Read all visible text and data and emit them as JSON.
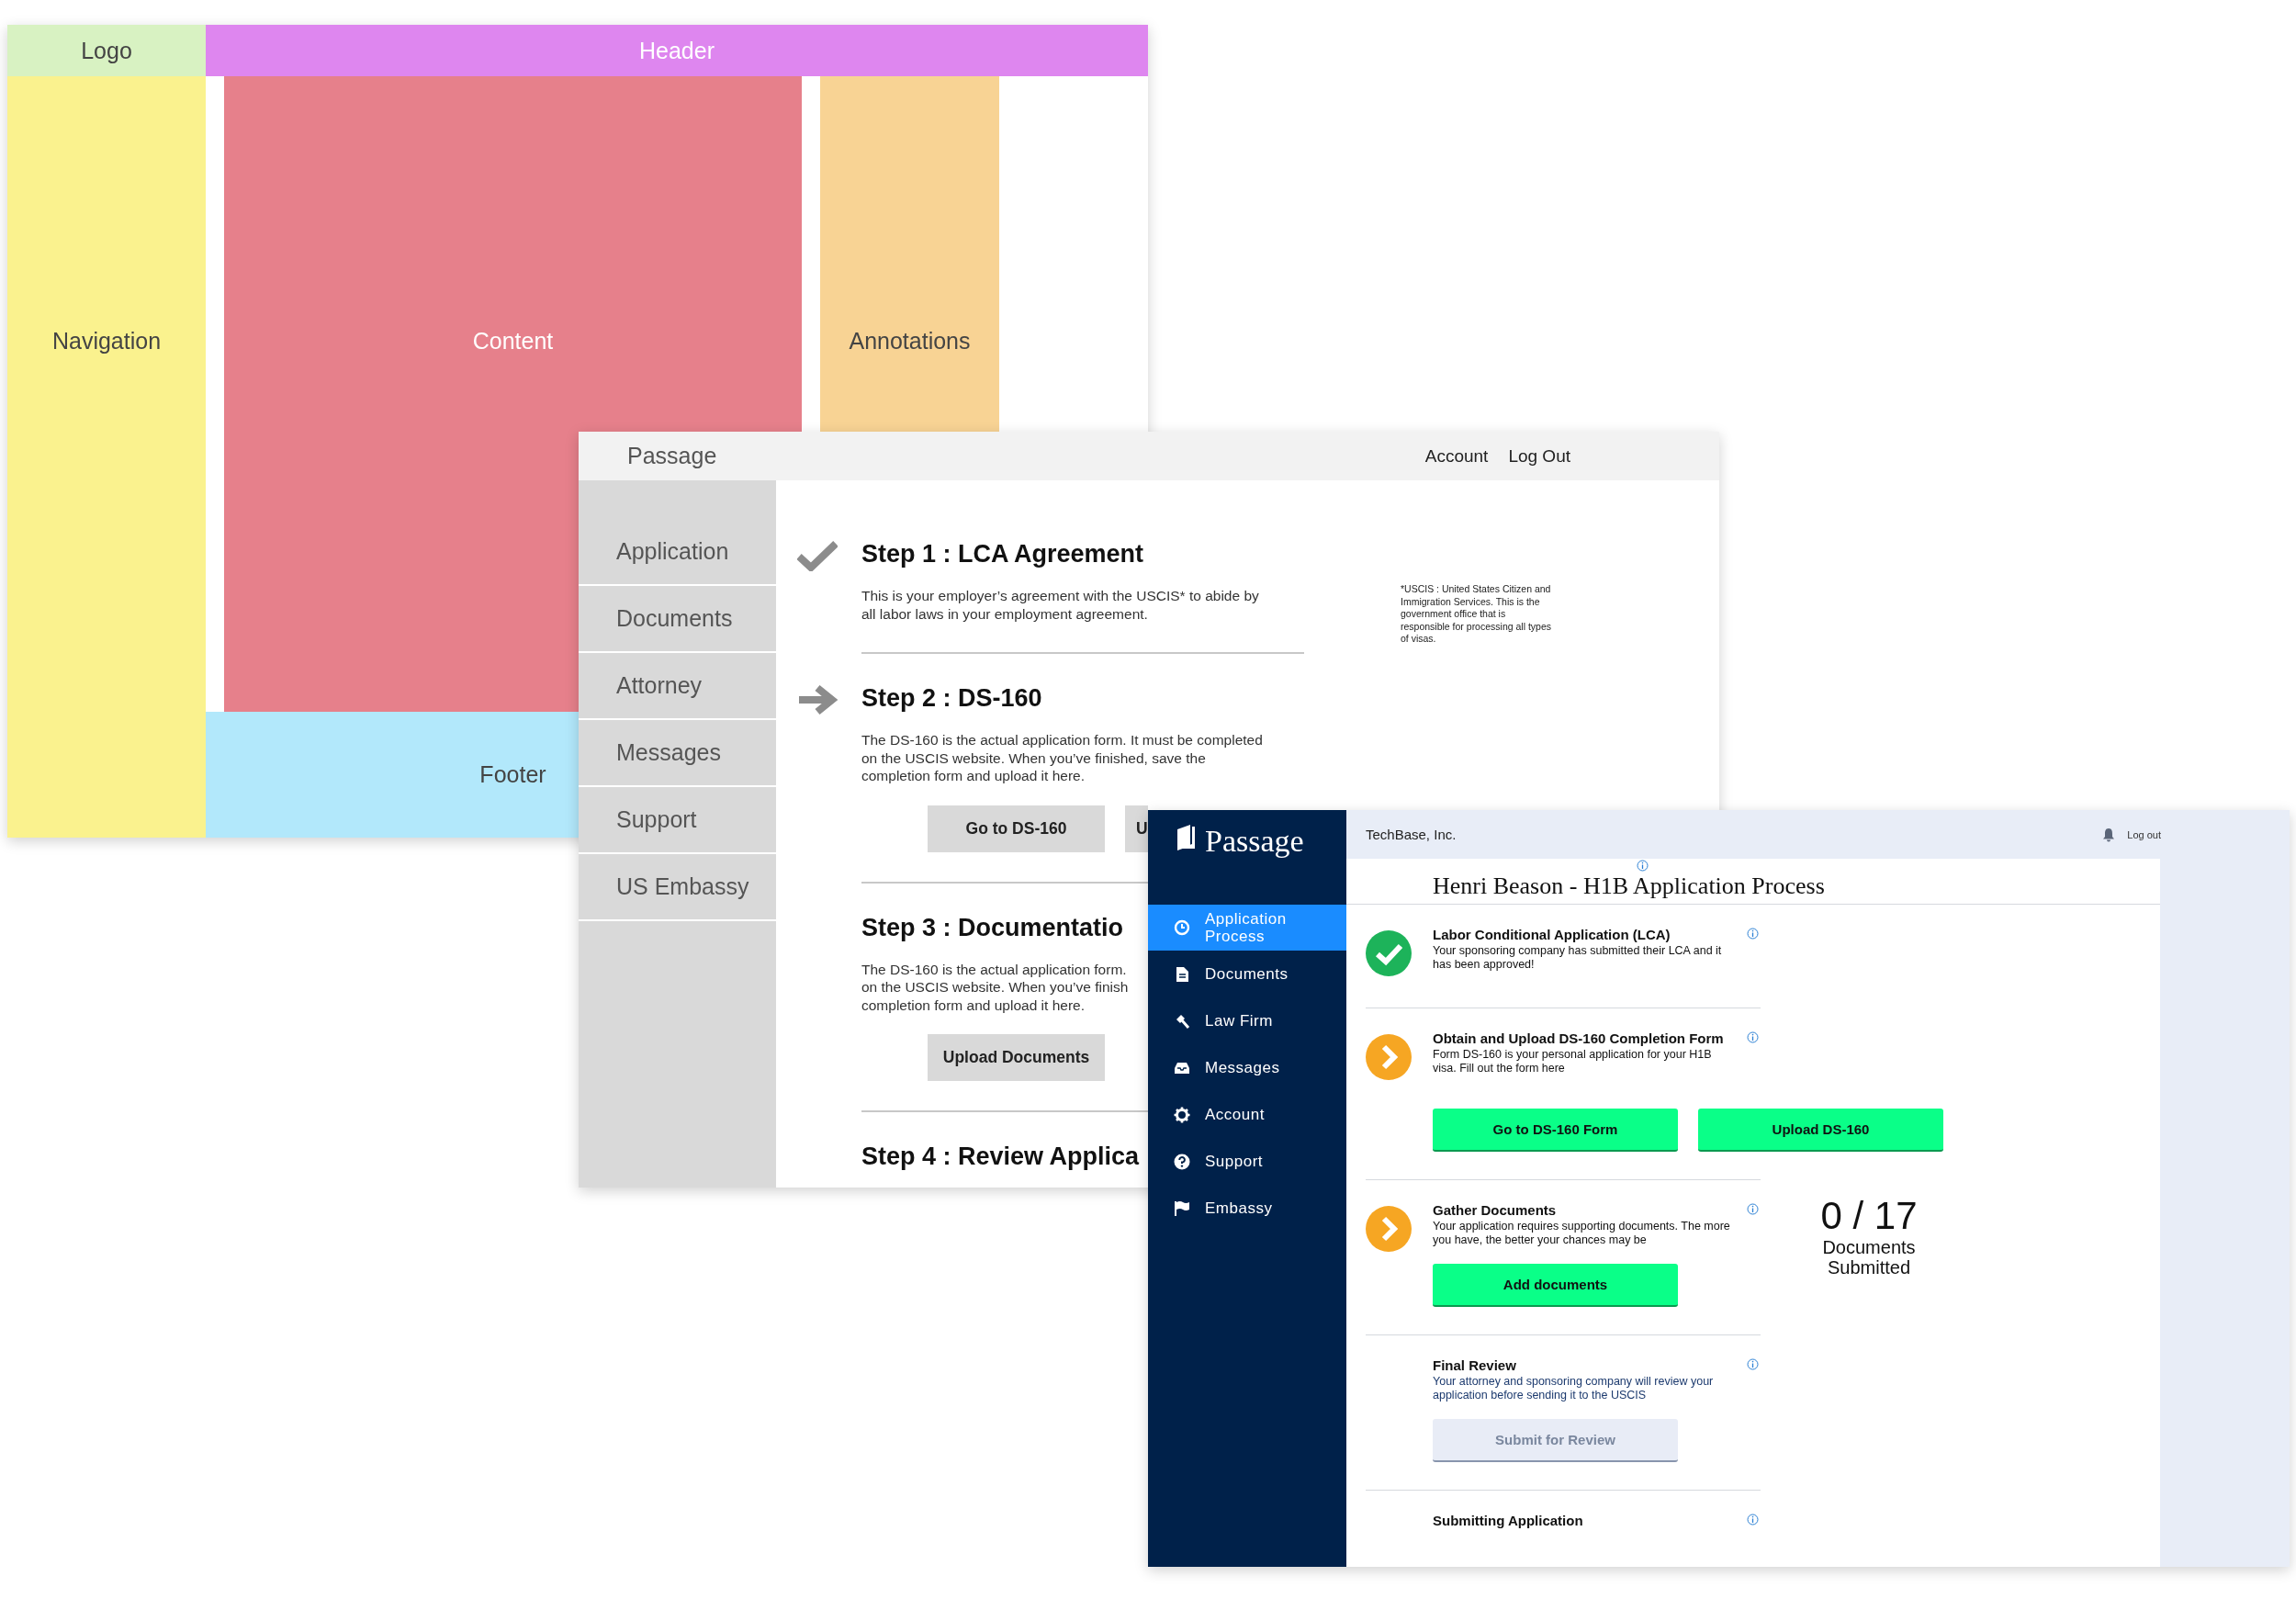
{
  "layout_wireframe": {
    "regions": [
      {
        "kind": "logo",
        "label": "Logo",
        "color": "#d8f2c2"
      },
      {
        "kind": "header",
        "label": "Header",
        "color": "#de86ef"
      },
      {
        "kind": "navigation",
        "label": "Navigation",
        "color": "#faf28e"
      },
      {
        "kind": "content",
        "label": "Content",
        "color": "#e6808b"
      },
      {
        "kind": "annotations",
        "label": "Annotations",
        "color": "#f8d394"
      },
      {
        "kind": "footer",
        "label": "Footer",
        "color": "#b2e8fb"
      }
    ]
  },
  "wireframe": {
    "brand": "Passage",
    "top_links": [
      "Account",
      "Log Out"
    ],
    "nav_items": [
      "Application",
      "Documents",
      "Attorney",
      "Messages",
      "Support",
      "US Embassy"
    ],
    "steps": [
      {
        "kind": "done",
        "title": "Step 1 : LCA Agreement",
        "description": "This is your employer’s agreement with the USCIS* to abide by\nall labor laws in your employment agreement."
      },
      {
        "kind": "current",
        "title": "Step 2 : DS-160",
        "description": "The DS-160 is the actual application form. It must be completed\non the USCIS website. When you’ve finished, save the\ncompletion form and upload it here.",
        "buttons": [
          "Go to DS-160",
          "U"
        ]
      },
      {
        "kind": "plain",
        "title": "Step 3 : Documentatio",
        "description": "The DS-160 is the actual application form.\non the USCIS website. When you’ve finish\ncompletion form and upload it here.",
        "buttons": [
          "Upload Documents"
        ]
      },
      {
        "kind": "plain",
        "title": "Step 4 : Review Applica"
      }
    ],
    "annotation": "*USCIS : United States Citizen and Immigration Services. This is the government office that is responsible for processing all types of visas."
  },
  "app": {
    "brand": "Passage",
    "company": "TechBase, Inc.",
    "logout": "Log out",
    "nav": [
      {
        "label": "Application Process",
        "selected": true
      },
      {
        "label": "Documents",
        "selected": false
      },
      {
        "label": "Law Firm",
        "selected": false
      },
      {
        "label": "Messages",
        "selected": false
      },
      {
        "label": "Account",
        "selected": false
      },
      {
        "label": "Support",
        "selected": false
      },
      {
        "label": "Embassy",
        "selected": false
      }
    ],
    "title": "Henri Beason - H1B Application Process",
    "sections": [
      {
        "kind": "done",
        "title": "Labor Conditional Application (LCA)",
        "description": "Your sponsoring company has submitted their LCA and it has been approved!"
      },
      {
        "kind": "current",
        "title": "Obtain and Upload DS-160 Completion Form",
        "description": "Form DS-160 is your personal application for your H1B visa. Fill out the form here",
        "buttons": [
          {
            "label": "Go to DS-160 Form",
            "disabled": false
          },
          {
            "label": "Upload DS-160",
            "disabled": false
          }
        ]
      },
      {
        "kind": "current",
        "title": "Gather Documents",
        "description": "Your application requires supporting documents. The more you have, the better your chances may be",
        "buttons": [
          {
            "label": "Add documents",
            "disabled": false
          }
        ],
        "counter": {
          "value": "0 / 17",
          "label": "Documents Submitted"
        }
      },
      {
        "kind": "note",
        "title": "Final Review",
        "description": "Your attorney and sponsoring company will review your application before sending it to the USCIS",
        "buttons": [
          {
            "label": "Submit for Review",
            "disabled": true
          }
        ]
      },
      {
        "kind": "plain",
        "title": "Submitting Application"
      }
    ]
  }
}
